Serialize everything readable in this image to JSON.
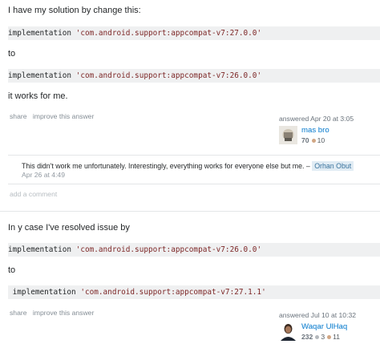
{
  "answer1": {
    "text_intro": "I have my solution by change this:",
    "code1_kw": "implementation ",
    "code1_str": "'com.android.support:appcompat-v7:27.0.0'",
    "text_to": "to",
    "code2_kw": "implementation ",
    "code2_str": "'com.android.support:appcompat-v7:26.0.0'",
    "text_outro": "it works for me.",
    "menu": {
      "share": "share",
      "improve": "improve this answer"
    },
    "answered": "answered Apr 20 at 3:05",
    "user": {
      "name": "mas bro",
      "rep": "70",
      "bronze": "10"
    },
    "comment": {
      "text": "This didn't work me unfortunately. Interestingly, everything works for everyone else but me. –",
      "user": "Orhan Obut",
      "time": "Apr 26 at 4:49"
    },
    "add_comment": "add a comment"
  },
  "answer2": {
    "text_intro": "In y case I've resolved issue by",
    "code1_kw": "implementation ",
    "code1_str": "'com.android.support:appcompat-v7:26.0.0'",
    "text_to": "to",
    "code2_kw": " implementation ",
    "code2_str": "'com.android.support:appcompat-v7:27.1.1'",
    "menu": {
      "share": "share",
      "improve": "improve this answer"
    },
    "answered": "answered Jul 10 at 10:32",
    "user": {
      "name": "Waqar UlHaq",
      "rep": "232",
      "silver": "3",
      "bronze": "11"
    }
  }
}
